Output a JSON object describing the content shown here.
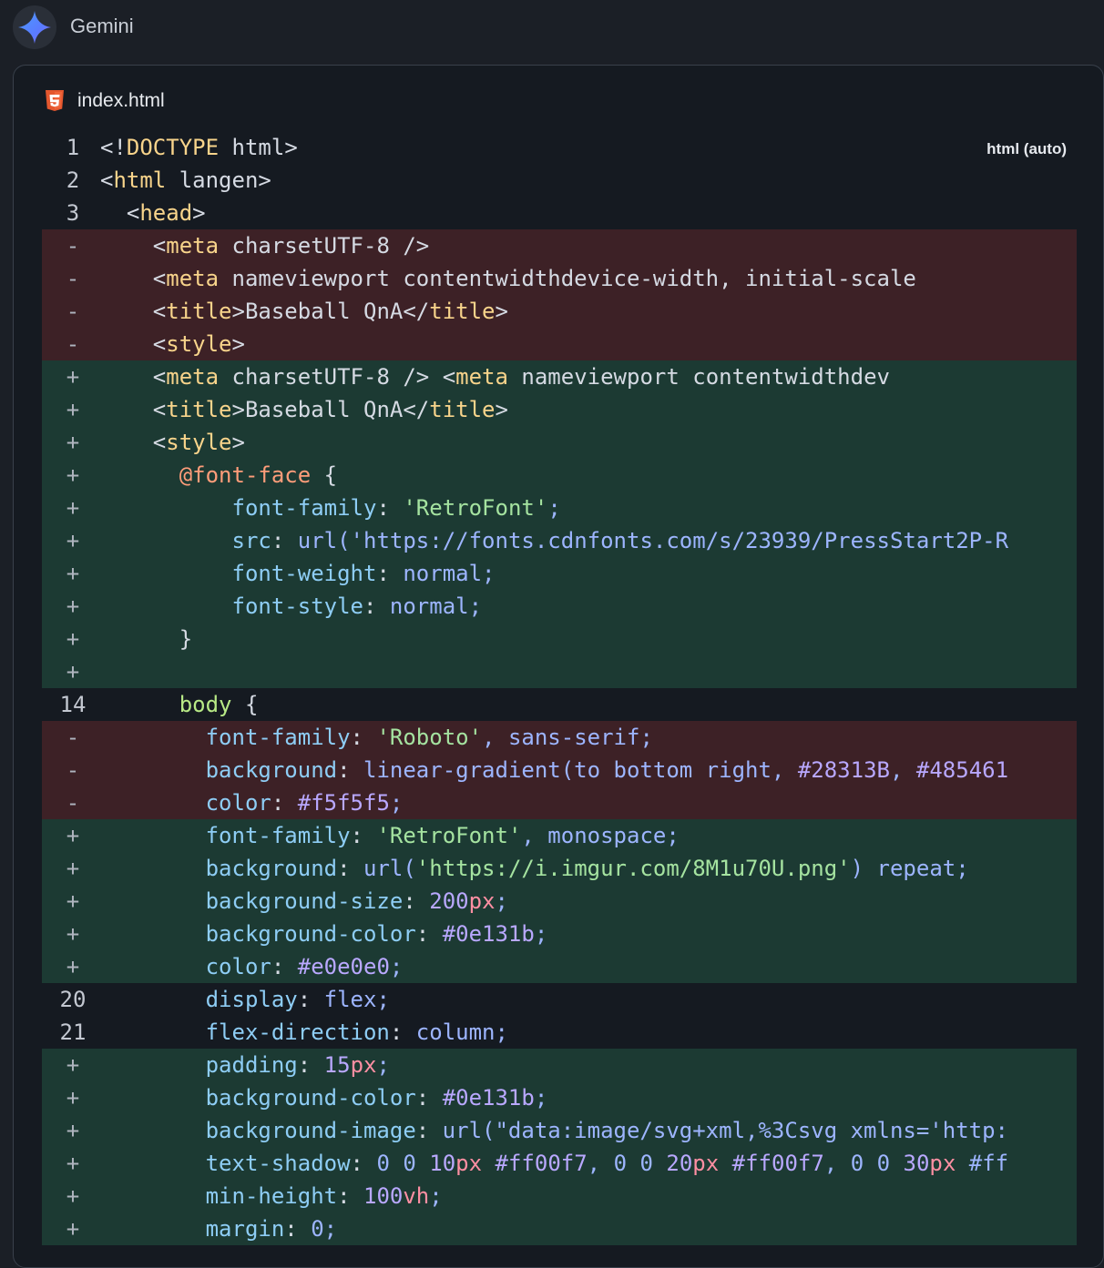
{
  "app": {
    "assistant_name": "Gemini",
    "avatar_icon": "gemini-sparkle-icon"
  },
  "file": {
    "name": "index.html",
    "icon": "html5-icon",
    "language_label": "html (auto)"
  },
  "colors": {
    "deleted_bg": "#3d2126",
    "added_bg": "#1c3a33",
    "panel_bg": "#151a21"
  },
  "lines": [
    {
      "type": "ctx",
      "num": "1",
      "text": "<!DOCTYPE html>"
    },
    {
      "type": "ctx",
      "num": "2",
      "text": "<html lang=\"en\">"
    },
    {
      "type": "ctx",
      "num": "3",
      "text": "  <head>"
    },
    {
      "type": "del",
      "num": "-",
      "text": "    <meta charset=\"UTF-8\" />"
    },
    {
      "type": "del",
      "num": "-",
      "text": "    <meta name=\"viewport\" content=\"width=device-width, initial-scale="
    },
    {
      "type": "del",
      "num": "-",
      "text": "    <title>Baseball QnA</title>"
    },
    {
      "type": "del",
      "num": "-",
      "text": "    <style>"
    },
    {
      "type": "add",
      "num": "+",
      "text": "    <meta charset=\"UTF-8\" /> <meta name=\"viewport\" content=\"width=dev"
    },
    {
      "type": "add",
      "num": "+",
      "text": "    <title>Baseball QnA</title>"
    },
    {
      "type": "add",
      "num": "+",
      "text": "    <style>"
    },
    {
      "type": "add",
      "num": "+",
      "text": "      @font-face {"
    },
    {
      "type": "add",
      "num": "+",
      "text": "          font-family: 'RetroFont';"
    },
    {
      "type": "add",
      "num": "+",
      "text": "          src: url('https://fonts.cdnfonts.com/s/23939/PressStart2P-R"
    },
    {
      "type": "add",
      "num": "+",
      "text": "          font-weight: normal;"
    },
    {
      "type": "add",
      "num": "+",
      "text": "          font-style: normal;"
    },
    {
      "type": "add",
      "num": "+",
      "text": "      }"
    },
    {
      "type": "add",
      "num": "+",
      "text": ""
    },
    {
      "type": "ctx",
      "num": "14",
      "text": "      body {"
    },
    {
      "type": "del",
      "num": "-",
      "text": "        font-family: 'Roboto', sans-serif;"
    },
    {
      "type": "del",
      "num": "-",
      "text": "        background: linear-gradient(to bottom right, #28313B, #485461"
    },
    {
      "type": "del",
      "num": "-",
      "text": "        color: #f5f5f5;"
    },
    {
      "type": "add",
      "num": "+",
      "text": "        font-family: 'RetroFont', monospace;"
    },
    {
      "type": "add",
      "num": "+",
      "text": "        background: url('https://i.imgur.com/8M1u70U.png') repeat;"
    },
    {
      "type": "add",
      "num": "+",
      "text": "        background-size: 200px;"
    },
    {
      "type": "add",
      "num": "+",
      "text": "        background-color: #0e131b;"
    },
    {
      "type": "add",
      "num": "+",
      "text": "        color: #e0e0e0;"
    },
    {
      "type": "ctx",
      "num": "20",
      "text": "        display: flex;"
    },
    {
      "type": "ctx",
      "num": "21",
      "text": "        flex-direction: column;"
    },
    {
      "type": "add",
      "num": "+",
      "text": "        padding: 15px;"
    },
    {
      "type": "add",
      "num": "+",
      "text": "        background-color: #0e131b;"
    },
    {
      "type": "add",
      "num": "+",
      "text": "        background-image: url(\"data:image/svg+xml,%3Csvg xmlns='http:"
    },
    {
      "type": "add",
      "num": "+",
      "text": "        text-shadow: 0 0 10px #ff00f7, 0 0 20px #ff00f7, 0 0 30px #ff"
    },
    {
      "type": "add",
      "num": "+",
      "text": "        min-height: 100vh;"
    },
    {
      "type": "add",
      "num": "+",
      "text": "        margin: 0;"
    }
  ]
}
